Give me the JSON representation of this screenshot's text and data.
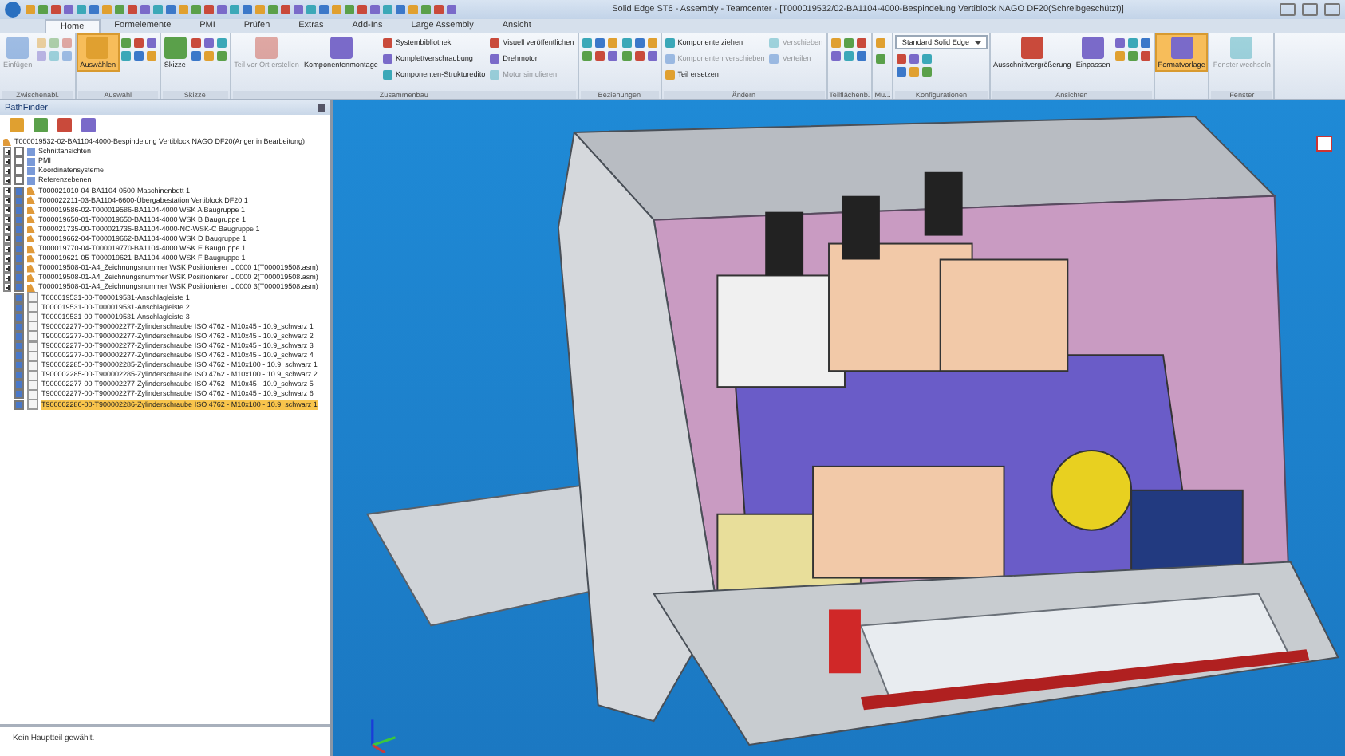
{
  "window": {
    "title": "Solid Edge ST6 - Assembly - Teamcenter - [T000019532/02-BA1104-4000-Bespindelung Vertiblock NAGO DF20(Schreibgeschützt)]"
  },
  "ribbon": {
    "tabs": [
      {
        "label": "Home",
        "selected": true
      },
      {
        "label": "Formelemente",
        "selected": false
      },
      {
        "label": "PMI",
        "selected": false
      },
      {
        "label": "Prüfen",
        "selected": false
      },
      {
        "label": "Extras",
        "selected": false
      },
      {
        "label": "Add-Ins",
        "selected": false
      },
      {
        "label": "Large Assembly",
        "selected": false
      },
      {
        "label": "Ansicht",
        "selected": false
      }
    ],
    "groups": [
      {
        "label": "Zwischenabl.",
        "columns": [
          [
            {
              "kind": "large",
              "label": "Einfügen",
              "disabled": true,
              "active": false
            }
          ],
          [
            {
              "kind": "icons",
              "disabled": true,
              "active": false
            }
          ]
        ]
      },
      {
        "label": "Auswahl",
        "columns": [
          [
            {
              "kind": "large",
              "label": "Auswählen",
              "disabled": false,
              "active": true
            }
          ],
          [
            {
              "kind": "icons",
              "disabled": false,
              "active": false
            }
          ]
        ]
      },
      {
        "label": "Skizze",
        "columns": [
          [
            {
              "kind": "large",
              "label": "Skizze",
              "disabled": false,
              "active": false
            }
          ],
          [
            {
              "kind": "icons",
              "disabled": false,
              "active": false
            }
          ]
        ]
      },
      {
        "label": "Zusammenbau",
        "columns": [
          [
            {
              "kind": "large",
              "label": "Teil vor Ort erstellen",
              "disabled": true,
              "active": false
            }
          ],
          [
            {
              "kind": "large",
              "label": "Komponentenmontage",
              "disabled": false,
              "active": false
            }
          ],
          [
            {
              "kind": "small",
              "label": "Systembibliothek",
              "disabled": false,
              "active": false
            },
            {
              "kind": "small",
              "label": "Komplettverschraubung",
              "disabled": false,
              "active": false
            },
            {
              "kind": "small",
              "label": "Komponenten-Strukturedito",
              "disabled": false,
              "active": false
            }
          ],
          [
            {
              "kind": "small",
              "label": "Visuell veröffentlichen",
              "disabled": false,
              "active": false
            },
            {
              "kind": "small",
              "label": "Drehmotor",
              "disabled": false,
              "active": false
            },
            {
              "kind": "small",
              "label": "Motor simulieren",
              "disabled": true,
              "active": false
            }
          ]
        ]
      },
      {
        "label": "Beziehungen",
        "columns": [
          [
            {
              "kind": "icons",
              "disabled": false,
              "active": false
            }
          ],
          [
            {
              "kind": "icons",
              "disabled": false,
              "active": false
            }
          ]
        ]
      },
      {
        "label": "Ändern",
        "columns": [
          [
            {
              "kind": "small",
              "label": "Komponente ziehen",
              "disabled": false,
              "active": false
            },
            {
              "kind": "small",
              "label": "Komponenten verschieben",
              "disabled": true,
              "active": false
            },
            {
              "kind": "small",
              "label": "Teil ersetzen",
              "disabled": false,
              "active": false
            }
          ],
          [
            {
              "kind": "small",
              "label": "Verschieben",
              "disabled": true,
              "active": false
            },
            {
              "kind": "small",
              "label": "Verteilen",
              "disabled": true,
              "active": false
            }
          ]
        ]
      },
      {
        "label": "Teilflächenb.",
        "columns": [
          [
            {
              "kind": "icons",
              "disabled": false,
              "active": false
            }
          ]
        ]
      },
      {
        "label": "Mu...",
        "columns": [
          [
            {
              "kind": "small",
              "disabled": false,
              "active": false
            },
            {
              "kind": "small",
              "disabled": false,
              "active": false
            }
          ]
        ]
      },
      {
        "label": "Konfigurationen",
        "columns": [
          [
            {
              "kind": "dropdown",
              "label": "Standard Solid Edge",
              "disabled": false,
              "active": false
            },
            {
              "kind": "icons",
              "disabled": false,
              "active": false
            }
          ]
        ]
      },
      {
        "label": "Ansichten",
        "columns": [
          [
            {
              "kind": "large",
              "label": "Ausschnittvergrößerung",
              "disabled": false,
              "active": false
            }
          ],
          [
            {
              "kind": "large",
              "label": "Einpassen",
              "disabled": false,
              "active": false
            }
          ],
          [
            {
              "kind": "icons",
              "disabled": false,
              "active": false
            }
          ]
        ]
      },
      {
        "columns": [
          [
            {
              "kind": "large",
              "label": "Formatvorlage",
              "disabled": false,
              "active": true
            }
          ]
        ]
      },
      {
        "label": "Fenster",
        "columns": [
          [
            {
              "kind": "large",
              "label": "Fenster wechseln",
              "disabled": true,
              "active": false
            }
          ]
        ]
      }
    ]
  },
  "pathfinder": {
    "title": "PathFinder",
    "tree": [
      {
        "label": "T000019532-02-BA1104-4000-Bespindelung Vertiblock NAGO DF20(Anger in Bearbeitung)",
        "children": [
          {
            "label": "Schnittansichten",
            "expanded": false,
            "checked": false,
            "selected": false,
            "kind": "feature"
          },
          {
            "label": "PMI",
            "expanded": false,
            "checked": false,
            "selected": false,
            "kind": "feature"
          },
          {
            "label": "Koordinatensysteme",
            "expanded": false,
            "checked": false,
            "selected": false,
            "kind": "feature"
          },
          {
            "label": "Referenzebenen",
            "expanded": false,
            "checked": false,
            "selected": false,
            "kind": "feature"
          },
          {
            "label": "T000021010-04-BA1104-0500-Maschinenbett 1",
            "expanded": false,
            "checked": true,
            "selected": false,
            "kind": "assembly"
          },
          {
            "label": "T000022211-03-BA1104-6600-Übergabestation Vertiblock DF20 1",
            "expanded": false,
            "checked": true,
            "selected": false,
            "kind": "assembly"
          },
          {
            "label": "T000019586-02-T000019586-BA1104-4000 WSK A Baugruppe 1",
            "expanded": false,
            "checked": true,
            "selected": false,
            "kind": "assembly"
          },
          {
            "label": "T000019650-01-T000019650-BA1104-4000 WSK B Baugruppe 1",
            "expanded": false,
            "checked": true,
            "selected": false,
            "kind": "assembly"
          },
          {
            "label": "T000021735-00-T000021735-BA1104-4000-NC-WSK-C Baugruppe 1",
            "expanded": false,
            "checked": true,
            "selected": false,
            "kind": "assembly"
          },
          {
            "label": "T000019662-04-T000019662-BA1104-4000 WSK D Baugruppe 1",
            "expanded": false,
            "checked": true,
            "selected": false,
            "kind": "assembly"
          },
          {
            "label": "T000019770-04-T000019770-BA1104-4000 WSK E Baugruppe 1",
            "expanded": false,
            "checked": true,
            "selected": false,
            "kind": "assembly"
          },
          {
            "label": "T000019621-05-T000019621-BA1104-4000 WSK F Baugruppe 1",
            "expanded": false,
            "checked": true,
            "selected": false,
            "kind": "assembly"
          },
          {
            "label": "T000019508-01-A4_Zeichnungsnummer WSK Positionierer L 0000 1(T000019508.asm)",
            "expanded": false,
            "checked": true,
            "selected": false,
            "kind": "assembly"
          },
          {
            "label": "T000019508-01-A4_Zeichnungsnummer WSK Positionierer L 0000 2(T000019508.asm)",
            "expanded": false,
            "checked": true,
            "selected": false,
            "kind": "assembly"
          },
          {
            "label": "T000019508-01-A4_Zeichnungsnummer WSK Positionierer L 0000 3(T000019508.asm)",
            "expanded": false,
            "checked": true,
            "selected": false,
            "kind": "assembly"
          },
          {
            "label": "T000019531-00-T000019531-Anschlagleiste 1",
            "checked": true,
            "selected": false,
            "kind": "part"
          },
          {
            "label": "T000019531-00-T000019531-Anschlagleiste 2",
            "checked": true,
            "selected": false,
            "kind": "part"
          },
          {
            "label": "T000019531-00-T000019531-Anschlagleiste 3",
            "checked": true,
            "selected": false,
            "kind": "part"
          },
          {
            "label": "T900002277-00-T900002277-Zylinderschraube ISO 4762 - M10x45 - 10.9_schwarz 1",
            "checked": true,
            "selected": false,
            "kind": "part"
          },
          {
            "label": "T900002277-00-T900002277-Zylinderschraube ISO 4762 - M10x45 - 10.9_schwarz 2",
            "checked": true,
            "selected": false,
            "kind": "part"
          },
          {
            "label": "T900002277-00-T900002277-Zylinderschraube ISO 4762 - M10x45 - 10.9_schwarz 3",
            "checked": true,
            "selected": false,
            "kind": "part"
          },
          {
            "label": "T900002277-00-T900002277-Zylinderschraube ISO 4762 - M10x45 - 10.9_schwarz 4",
            "checked": true,
            "selected": false,
            "kind": "part"
          },
          {
            "label": "T900002285-00-T900002285-Zylinderschraube ISO 4762 - M10x100 - 10.9_schwarz 1",
            "checked": true,
            "selected": false,
            "kind": "part"
          },
          {
            "label": "T900002285-00-T900002285-Zylinderschraube ISO 4762 - M10x100 - 10.9_schwarz 2",
            "checked": true,
            "selected": false,
            "kind": "part"
          },
          {
            "label": "T900002277-00-T900002277-Zylinderschraube ISO 4762 - M10x45 - 10.9_schwarz 5",
            "checked": true,
            "selected": false,
            "kind": "part"
          },
          {
            "label": "T900002277-00-T900002277-Zylinderschraube ISO 4762 - M10x45 - 10.9_schwarz 6",
            "checked": true,
            "selected": false,
            "kind": "part"
          },
          {
            "label": "T900002286-00-T900002286-Zylinderschraube ISO 4762 - M10x100 - 10.9_schwarz 1",
            "checked": true,
            "selected": true,
            "kind": "part"
          }
        ]
      }
    ]
  },
  "status_bar": {
    "text": "Kein Hauptteil gewählt."
  }
}
